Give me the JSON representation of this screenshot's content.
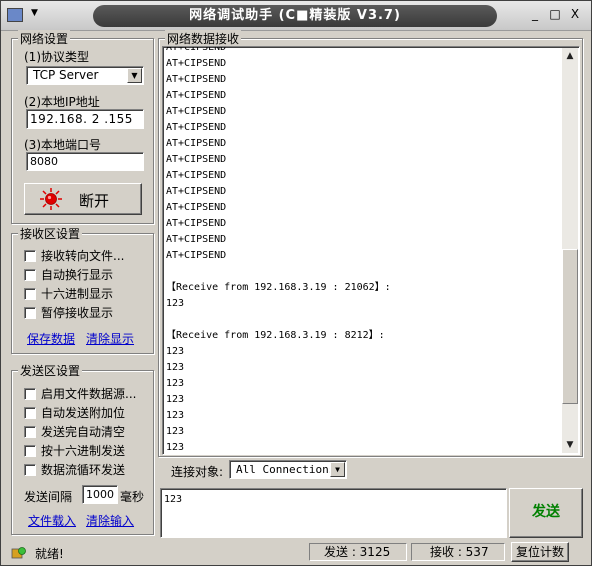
{
  "window": {
    "title": "网络调试助手 (C■精装版 V3.7)",
    "controls": {
      "minimize": "_",
      "maximize": "□",
      "close": "X"
    }
  },
  "network_settings": {
    "title": "网络设置",
    "protocol_label": "(1)协议类型",
    "protocol_value": "TCP Server",
    "ip_label": "(2)本地IP地址",
    "ip_value": "192.168. 2 .155",
    "port_label": "(3)本地端口号",
    "port_value": "8080",
    "connect_button": "断开"
  },
  "receive_settings": {
    "title": "接收区设置",
    "options": [
      {
        "label": "接收转向文件...",
        "checked": false
      },
      {
        "label": "自动换行显示",
        "checked": false
      },
      {
        "label": "十六进制显示",
        "checked": false
      },
      {
        "label": "暂停接收显示",
        "checked": false
      }
    ],
    "save_link": "保存数据",
    "clear_link": "清除显示"
  },
  "send_settings": {
    "title": "发送区设置",
    "options": [
      {
        "label": "启用文件数据源...",
        "checked": false
      },
      {
        "label": "自动发送附加位",
        "checked": false
      },
      {
        "label": "发送完自动清空",
        "checked": false
      },
      {
        "label": "按十六进制发送",
        "checked": false
      },
      {
        "label": "数据流循环发送",
        "checked": false
      }
    ],
    "interval_label": "发送间隔",
    "interval_value": "1000",
    "interval_unit": "毫秒",
    "load_file_link": "文件载入",
    "clear_input_link": "清除输入"
  },
  "receive_area": {
    "title": "网络数据接收",
    "lines": [
      "AT+CIPSEND",
      "AT+CIPSEND",
      "AT+CIPSEND",
      "AT+CIPSEND",
      "AT+CIPSEND",
      "AT+CIPSEND",
      "AT+CIPSEND",
      "AT+CIPSEND",
      "AT+CIPSEND",
      "AT+CIPSEND",
      "AT+CIPSEND",
      "AT+CIPSEND",
      "AT+CIPSEND",
      "AT+CIPSEND",
      "",
      "【Receive from 192.168.3.19 : 21062】:",
      "123",
      "",
      "【Receive from 192.168.3.19 : 8212】:",
      "123",
      "123",
      "123",
      "123",
      "123",
      "123",
      "123"
    ],
    "scroll_position": 0.85
  },
  "connection": {
    "label": "连接对象:",
    "value": "All Connections"
  },
  "send_area": {
    "text": "123",
    "send_button": "发送"
  },
  "status_bar": {
    "status": "就绪!",
    "sent_label": "发送 : 3125",
    "received_label": "接收 : 537",
    "reset_button": "复位计数"
  }
}
